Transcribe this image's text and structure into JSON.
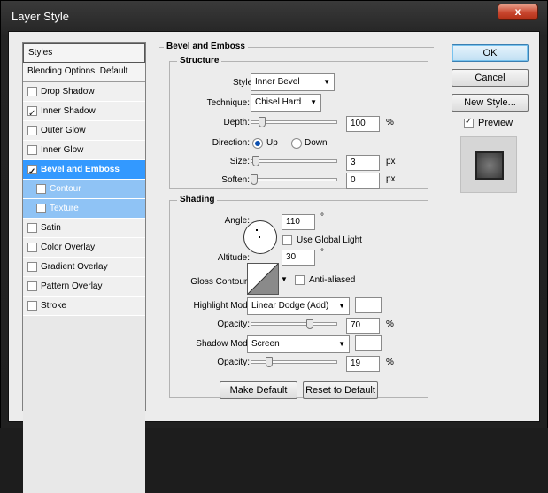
{
  "window": {
    "title": "Layer Style",
    "close_label": "x"
  },
  "styles_panel": {
    "header": "Styles",
    "blending": "Blending Options: Default",
    "effects": [
      {
        "label": "Drop Shadow",
        "checked": false
      },
      {
        "label": "Inner Shadow",
        "checked": true
      },
      {
        "label": "Outer Glow",
        "checked": false
      },
      {
        "label": "Inner Glow",
        "checked": false
      },
      {
        "label": "Bevel and Emboss",
        "checked": true,
        "selected": true
      },
      {
        "label": "Contour",
        "checked": false,
        "sub": true
      },
      {
        "label": "Texture",
        "checked": false,
        "sub": true
      },
      {
        "label": "Satin",
        "checked": false
      },
      {
        "label": "Color Overlay",
        "checked": false
      },
      {
        "label": "Gradient Overlay",
        "checked": false
      },
      {
        "label": "Pattern Overlay",
        "checked": false
      },
      {
        "label": "Stroke",
        "checked": false
      }
    ]
  },
  "bevel": {
    "title": "Bevel and Emboss",
    "structure": {
      "title": "Structure",
      "style_label": "Style:",
      "style_value": "Inner Bevel",
      "technique_label": "Technique:",
      "technique_value": "Chisel Hard",
      "depth_label": "Depth:",
      "depth_value": "100",
      "depth_unit": "%",
      "depth_level": 0.1,
      "direction_label": "Direction:",
      "dir_up": "Up",
      "dir_down": "Down",
      "direction": "Up",
      "size_label": "Size:",
      "size_value": "3",
      "size_unit": "px",
      "size_level": 0.02,
      "soften_label": "Soften:",
      "soften_value": "0",
      "soften_unit": "px",
      "soften_level": 0.0
    },
    "shading": {
      "title": "Shading",
      "angle_label": "Angle:",
      "angle_value": "110",
      "angle_unit": "°",
      "global_light_label": "Use Global Light",
      "global_light": false,
      "altitude_label": "Altitude:",
      "altitude_value": "30",
      "altitude_unit": "°",
      "gloss_label": "Gloss Contour:",
      "anti_aliased_label": "Anti-aliased",
      "anti_aliased": false,
      "highlight_label": "Highlight Mode:",
      "highlight_value": "Linear Dodge (Add)",
      "hl_opacity_label": "Opacity:",
      "hl_opacity_value": "70",
      "hl_opacity_unit": "%",
      "hl_opacity_level": 0.7,
      "shadow_label": "Shadow Mode:",
      "shadow_value": "Screen",
      "sh_opacity_label": "Opacity:",
      "sh_opacity_value": "19",
      "sh_opacity_unit": "%",
      "sh_opacity_level": 0.19
    },
    "make_default": "Make Default",
    "reset_default": "Reset to Default"
  },
  "buttons": {
    "ok": "OK",
    "cancel": "Cancel",
    "new_style": "New Style..."
  },
  "preview": {
    "label": "Preview",
    "checked": true
  }
}
